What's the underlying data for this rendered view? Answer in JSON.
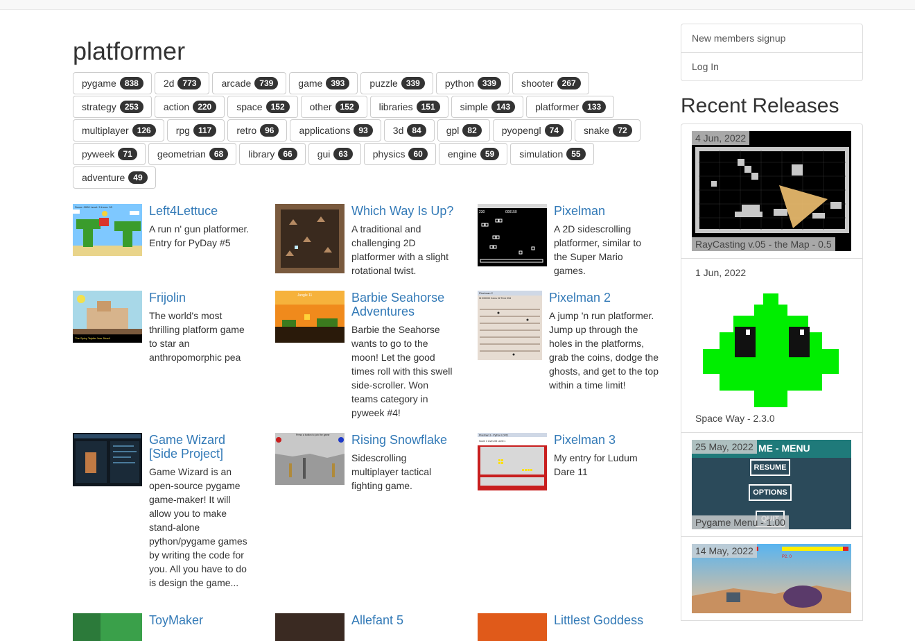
{
  "page": {
    "title": "platformer"
  },
  "tags": [
    {
      "label": "pygame",
      "count": "838"
    },
    {
      "label": "2d",
      "count": "773"
    },
    {
      "label": "arcade",
      "count": "739"
    },
    {
      "label": "game",
      "count": "393"
    },
    {
      "label": "puzzle",
      "count": "339"
    },
    {
      "label": "python",
      "count": "339"
    },
    {
      "label": "shooter",
      "count": "267"
    },
    {
      "label": "strategy",
      "count": "253"
    },
    {
      "label": "action",
      "count": "220"
    },
    {
      "label": "space",
      "count": "152"
    },
    {
      "label": "other",
      "count": "152"
    },
    {
      "label": "libraries",
      "count": "151"
    },
    {
      "label": "simple",
      "count": "143"
    },
    {
      "label": "platformer",
      "count": "133"
    },
    {
      "label": "multiplayer",
      "count": "126"
    },
    {
      "label": "rpg",
      "count": "117"
    },
    {
      "label": "retro",
      "count": "96"
    },
    {
      "label": "applications",
      "count": "93"
    },
    {
      "label": "3d",
      "count": "84"
    },
    {
      "label": "gpl",
      "count": "82"
    },
    {
      "label": "pyopengl",
      "count": "74"
    },
    {
      "label": "snake",
      "count": "72"
    },
    {
      "label": "pyweek",
      "count": "71"
    },
    {
      "label": "geometrian",
      "count": "68"
    },
    {
      "label": "library",
      "count": "66"
    },
    {
      "label": "gui",
      "count": "63"
    },
    {
      "label": "physics",
      "count": "60"
    },
    {
      "label": "engine",
      "count": "59"
    },
    {
      "label": "simulation",
      "count": "55"
    },
    {
      "label": "adventure",
      "count": "49"
    }
  ],
  "projects": [
    {
      "title": "Left4Lettuce",
      "desc": "A run n' gun platformer. Entry for PyDay #5"
    },
    {
      "title": "Which Way Is Up?",
      "desc": "A traditional and challenging 2D platformer with a slight rotational twist."
    },
    {
      "title": "Pixelman",
      "desc": "A 2D sidescrolling platformer, similar to the Super Mario games."
    },
    {
      "title": "Frijolin",
      "desc": "The world's most thrilling platform game to star an anthropomorphic pea"
    },
    {
      "title": "Barbie Seahorse Adventures",
      "desc": "Barbie the Seahorse wants to go to the moon! Let the good times roll with this swell side-scroller. Won teams category in pyweek #4!"
    },
    {
      "title": "Pixelman 2",
      "desc": "A jump 'n run platformer. Jump up through the holes in the platforms, grab the coins, dodge the ghosts, and get to the top within a time limit!"
    },
    {
      "title": "Game Wizard [Side Project]",
      "desc": "Game Wizard is an open-source pygame game-maker! It will allow you to make stand-alone python/pygame games by writing the code for you. All you have to do is design the game..."
    },
    {
      "title": "Rising Snowflake",
      "desc": "Sidescrolling multiplayer tactical fighting game."
    },
    {
      "title": "Pixelman 3",
      "desc": "My entry for Ludum Dare 11"
    },
    {
      "title": "ToyMaker",
      "desc": ""
    },
    {
      "title": "Allefant 5",
      "desc": ""
    },
    {
      "title": "Littlest Goddess",
      "desc": ""
    }
  ],
  "thumb_text": {
    "left4lettuce": "Score: 0000   Level: 5   Lives: 03",
    "frijolin": "The Spicy Tejuite Jam Jihadi",
    "barbie": "Jungle 11",
    "pixelman_hud": "230",
    "pixelman_score": "000150",
    "pixelman2_title": "Pixelman 2",
    "pixelman2_hud": "Hi 000000   Coins 02   Time 054",
    "pixelman3_title": "Pixelman 3 - Python LD#11",
    "pixelman3_hud": "Score 3   Lives 05   Level 1",
    "rising_snowflake": "Press a button to join the game"
  },
  "sidebar": {
    "signup": "New members signup",
    "login": "Log In",
    "recent_title": "Recent Releases"
  },
  "releases": [
    {
      "date": "4 Jun, 2022",
      "name": "RayCasting v.05 - the Map - 0.5"
    },
    {
      "date": "1 Jun, 2022",
      "name": "Space Way - 2.3.0"
    },
    {
      "date": "25 May, 2022",
      "name": "Pygame Menu - 1.00",
      "menu_title": "ME - MENU",
      "btn1": "RESUME",
      "btn2": "OPTIONS",
      "btn3": "QUIT"
    },
    {
      "date": "14 May, 2022",
      "name": "",
      "hud": "P2. 0"
    }
  ],
  "colors": {
    "link": "#337ab7",
    "badge": "#333333",
    "alien_green": "#00ee00",
    "menu_bg": "#2b4a5a",
    "menu_bar": "#1f7a7a"
  }
}
